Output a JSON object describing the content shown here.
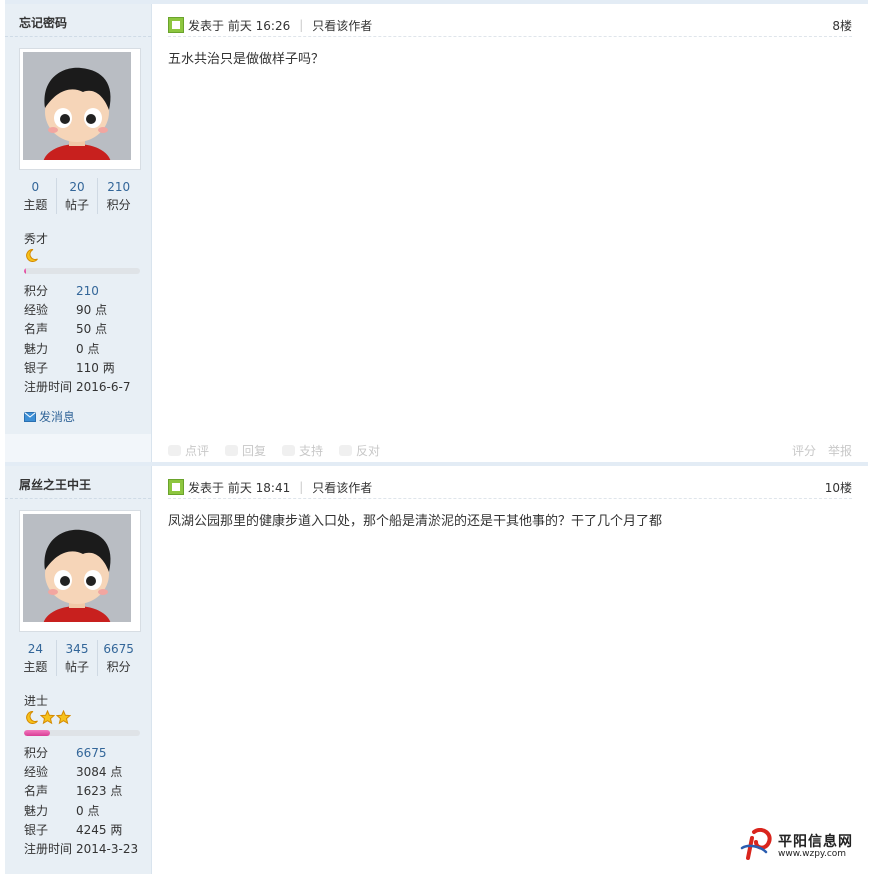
{
  "posts": [
    {
      "author": "忘记密码",
      "stats": [
        {
          "num": "0",
          "label": "主题"
        },
        {
          "num": "20",
          "label": "帖子"
        },
        {
          "num": "210",
          "label": "积分"
        }
      ],
      "rank": "秀才",
      "rank_icons": [
        "moon-icon"
      ],
      "progress_percent": 2,
      "info": [
        {
          "k": "积分",
          "v": "210"
        },
        {
          "k": "经验",
          "v": "90 点"
        },
        {
          "k": "名声",
          "v": "50 点"
        },
        {
          "k": "魅力",
          "v": "0 点"
        },
        {
          "k": "银子",
          "v": "110 两"
        },
        {
          "k": "注册时间",
          "v": "2016-6-7"
        }
      ],
      "send_message": "发消息",
      "posted_prefix": "发表于",
      "posted_time": "前天 16:26",
      "only_author": "只看该作者",
      "floor": "8楼",
      "content": "五水共治只是做做样子吗？",
      "actions": [
        "点评",
        "回复",
        "支持",
        "反对"
      ],
      "actions_right": [
        "评分",
        "举报"
      ]
    },
    {
      "author": "屌丝之王中王",
      "stats": [
        {
          "num": "24",
          "label": "主题"
        },
        {
          "num": "345",
          "label": "帖子"
        },
        {
          "num": "6675",
          "label": "积分"
        }
      ],
      "rank": "进士",
      "rank_icons": [
        "moon-icon",
        "star-icon",
        "star-icon"
      ],
      "progress_percent": 22,
      "info": [
        {
          "k": "积分",
          "v": "6675"
        },
        {
          "k": "经验",
          "v": "3084 点"
        },
        {
          "k": "名声",
          "v": "1623 点"
        },
        {
          "k": "魅力",
          "v": "0 点"
        },
        {
          "k": "银子",
          "v": "4245 两"
        },
        {
          "k": "注册时间",
          "v": "2014-3-23"
        }
      ],
      "posted_prefix": "发表于",
      "posted_time": "前天 18:41",
      "only_author": "只看该作者",
      "floor": "10楼",
      "content": "凤湖公园那里的健康步道入口处，那个船是清淤泥的还是干其他事的？干了几个月了都"
    }
  ],
  "watermark": {
    "name": "平阳信息网",
    "url": "www.wzpy.com"
  },
  "colors": {
    "link": "#336699",
    "sidebar_bg": "#e8eff5",
    "progress": "#e35aa9"
  }
}
